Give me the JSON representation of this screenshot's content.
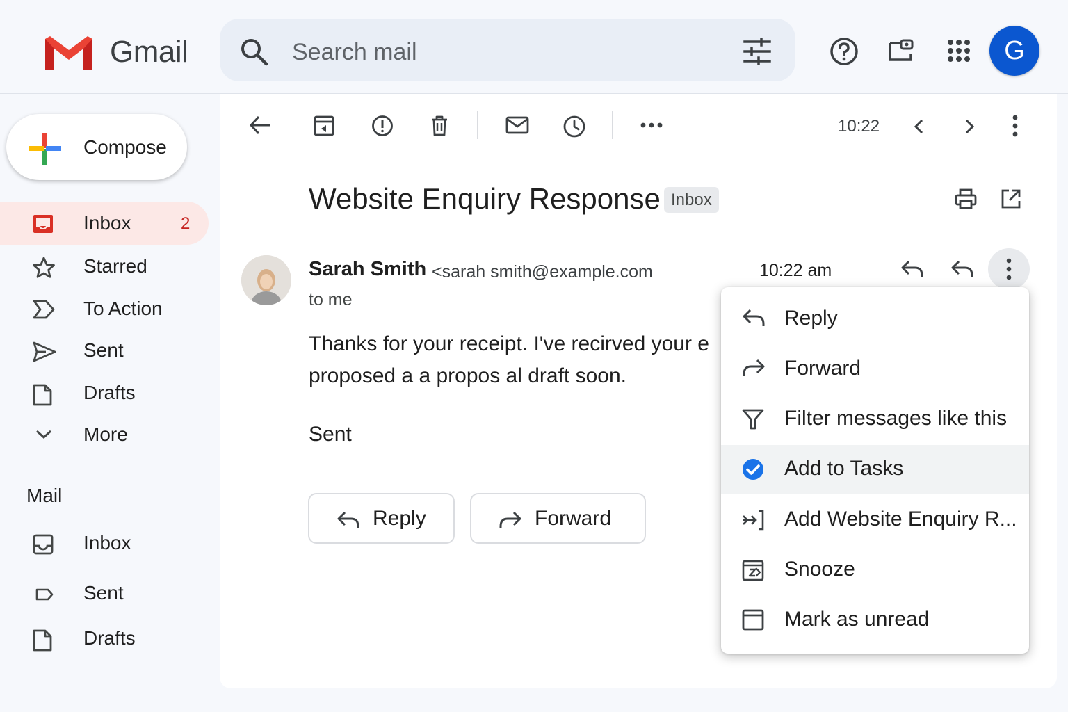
{
  "header": {
    "brand": "Gmail",
    "search_placeholder": "Search mail",
    "avatar_letter": "G"
  },
  "sidebar": {
    "compose_label": "Compose",
    "items": [
      {
        "label": "Inbox",
        "count": "2",
        "icon": "inbox-icon"
      },
      {
        "label": "Starred",
        "icon": "star-icon"
      },
      {
        "label": "To Action",
        "icon": "label-important-icon"
      },
      {
        "label": "Sent",
        "icon": "send-icon"
      },
      {
        "label": "Drafts",
        "icon": "draft-icon"
      },
      {
        "label": "More",
        "icon": "chevron-down-icon"
      }
    ],
    "mail_heading": "Mail",
    "mail_items": [
      {
        "label": "Inbox",
        "icon": "inbox-tray-icon"
      },
      {
        "label": "Sent",
        "icon": "label-icon"
      },
      {
        "label": "Drafts",
        "icon": "draft-icon"
      }
    ]
  },
  "toolbar": {
    "time": "10:22"
  },
  "email": {
    "subject": "Website Enquiry Response",
    "label": "Inbox",
    "sender_name": "Sarah Smith",
    "sender_email": "<sarah smith@example.com",
    "to": "to me",
    "time": "10:22 am",
    "body_line1": "Thanks for your receipt. I've recirved your e",
    "body_line2": "proposed a a propos al draft soon.",
    "signature": "Sent",
    "reply_label": "Reply",
    "forward_label": "Forward"
  },
  "menu": {
    "items": [
      {
        "label": "Reply",
        "icon": "reply-icon"
      },
      {
        "label": "Forward",
        "icon": "forward-icon"
      },
      {
        "label": "Filter messages like this",
        "icon": "filter-icon"
      },
      {
        "label": "Add to Tasks",
        "icon": "check-circle-icon",
        "highlighted": true
      },
      {
        "label": "Add Website Enquiry R...",
        "icon": "add-to-icon"
      },
      {
        "label": "Snooze",
        "icon": "snooze-icon"
      },
      {
        "label": "Mark as unread",
        "icon": "archive-box-icon"
      }
    ]
  },
  "colors": {
    "accent": "#0b57d0",
    "inbox_active_bg": "#fce8e6",
    "count_red": "#c5221f",
    "check_blue": "#1a73e8"
  }
}
